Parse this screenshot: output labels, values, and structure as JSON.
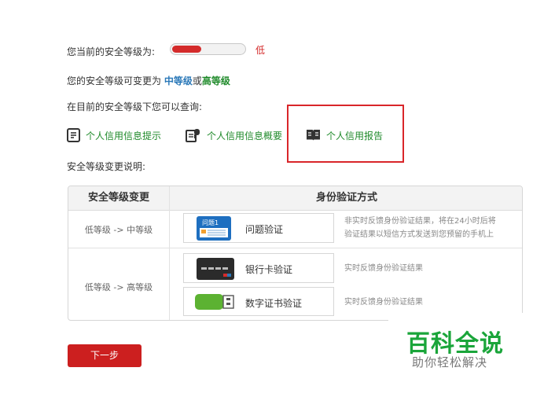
{
  "security": {
    "level_label": "您当前的安全等级为:",
    "level_value": "低",
    "level_fraction": 0.33,
    "change_prefix": "您的安全等级可变更为 ",
    "change_mid": "中等级",
    "change_or": "或",
    "change_high": "高等级",
    "query_heading": "在目前的安全等级下您可以查询:",
    "query_items": [
      {
        "label": "个人信用信息提示",
        "icon": "document-icon"
      },
      {
        "label": "个人信用信息概要",
        "icon": "document-p-icon"
      },
      {
        "label": "个人信用报告",
        "icon": "book-icon"
      }
    ],
    "explain_heading": "安全等级变更说明:"
  },
  "table": {
    "header_change": "安全等级变更",
    "header_method": "身份验证方式",
    "rows": [
      {
        "change": "低等级 -> 中等级",
        "methods": [
          {
            "label": "问题验证",
            "icon": "question-card-icon",
            "icon_text": "问题1",
            "desc": [
              "非实时反馈身份验证结果，将在24小时后将",
              "验证结果以短信方式发送到您预留的手机上"
            ]
          }
        ]
      },
      {
        "change": "低等级 -> 高等级",
        "methods": [
          {
            "label": "银行卡验证",
            "icon": "bank-card-icon",
            "desc": [
              "实时反馈身份验证结果"
            ]
          },
          {
            "label": "数字证书验证",
            "icon": "usb-key-icon",
            "desc": [
              "实时反馈身份验证结果"
            ]
          }
        ]
      }
    ]
  },
  "actions": {
    "next_label": "下一步"
  },
  "watermark": {
    "main": "百科全说",
    "sub": "助你轻松解决"
  },
  "colors": {
    "accent_red": "#cc1f1f",
    "green_link": "#1f8a2a",
    "blue": "#2a78b8"
  }
}
